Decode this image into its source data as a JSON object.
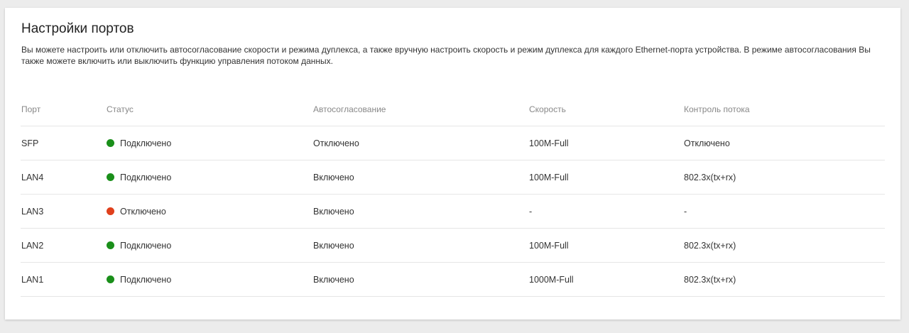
{
  "page": {
    "title": "Настройки портов",
    "description": "Вы можете настроить или отключить автосогласование скорости и режима дуплекса, а также вручную настроить скорость и режим дуплекса для каждого Ethernet-порта устройства. В режиме автосогласования Вы также можете включить или выключить функцию управления потоком данных."
  },
  "table": {
    "headers": {
      "port": "Порт",
      "status": "Статус",
      "autoneg": "Автосогласование",
      "speed": "Скорость",
      "flow": "Контроль потока"
    },
    "rows": [
      {
        "port": "SFP",
        "status": "Подключено",
        "status_color": "#1a8f1a",
        "autoneg": "Отключено",
        "speed": "100M-Full",
        "flow": "Отключено"
      },
      {
        "port": "LAN4",
        "status": "Подключено",
        "status_color": "#1a8f1a",
        "autoneg": "Включено",
        "speed": "100M-Full",
        "flow": "802.3x(tx+rx)"
      },
      {
        "port": "LAN3",
        "status": "Отключено",
        "status_color": "#e0401c",
        "autoneg": "Включено",
        "speed": "-",
        "flow": "-"
      },
      {
        "port": "LAN2",
        "status": "Подключено",
        "status_color": "#1a8f1a",
        "autoneg": "Включено",
        "speed": "100M-Full",
        "flow": "802.3x(tx+rx)"
      },
      {
        "port": "LAN1",
        "status": "Подключено",
        "status_color": "#1a8f1a",
        "autoneg": "Включено",
        "speed": "1000M-Full",
        "flow": "802.3x(tx+rx)"
      }
    ]
  }
}
